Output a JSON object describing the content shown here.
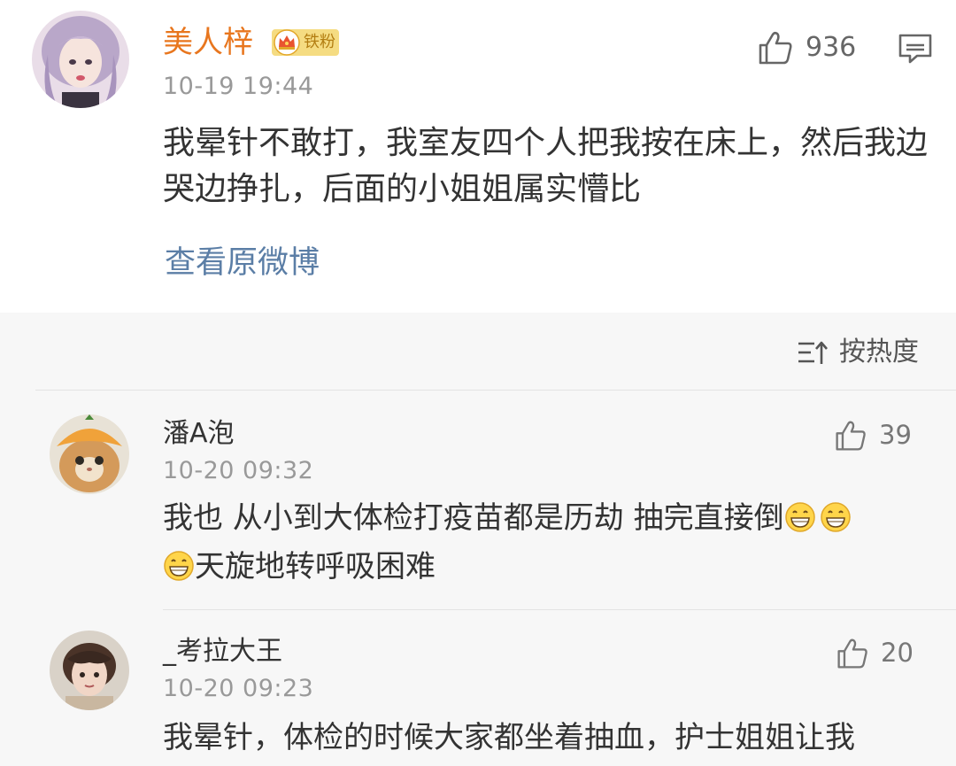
{
  "post": {
    "username": "美人梓",
    "badge": "铁粉",
    "time": "10-19 19:44",
    "likes": "936",
    "body": "我晕针不敢打，我室友四个人把我按在床上，然后我边哭边挣扎，后面的小姐姐属实懵比",
    "view_original": "查看原微博"
  },
  "sort": {
    "label": "按热度"
  },
  "comments": [
    {
      "username": "潘A泡",
      "time": "10-20 09:32",
      "likes": "39",
      "body_part1": "我也 从小到大体检打疫苗都是历劫 抽完直接倒",
      "body_part2": "天旋地转呼吸困难",
      "emoji": "grin-emoji"
    },
    {
      "username": "_考拉大王",
      "time": "10-20 09:23",
      "likes": "20",
      "body": "我晕针，体检的时候大家都坐着抽血，护士姐姐让我"
    }
  ],
  "colors": {
    "username_main": "#e8761e",
    "link": "#5b7ea6",
    "meta": "#999999",
    "badge_bg": "#f5dc82"
  },
  "icons": [
    "like-icon",
    "comment-icon",
    "sort-icon",
    "crown-icon",
    "grin-emoji"
  ]
}
